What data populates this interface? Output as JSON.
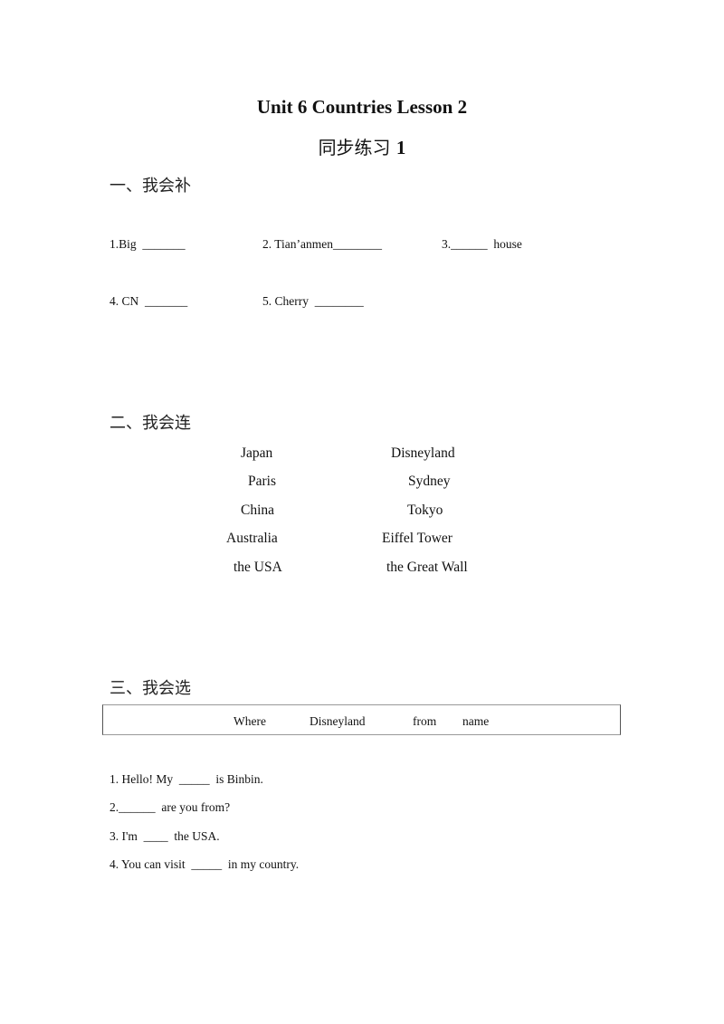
{
  "header": {
    "title": "Unit 6 Countries Lesson 2",
    "subtitle_text": "同步练习 ",
    "subtitle_num": "1"
  },
  "section1": {
    "heading": "一、我会补",
    "items": [
      "1.Big  _______",
      "2. Tian’anmen________",
      "3.______  house",
      "4. CN  _______",
      "5. Cherry  ________"
    ]
  },
  "section2": {
    "heading": "二、我会连",
    "left": [
      "Japan",
      "Paris",
      "China",
      "Australia",
      "the USA"
    ],
    "right": [
      "Disneyland",
      "Sydney",
      "Tokyo",
      "Eiffel Tower",
      "the Great Wall"
    ]
  },
  "section3": {
    "heading": "三、我会选",
    "word_bank": [
      "Where",
      "Disneyland",
      "from",
      "name"
    ],
    "questions": [
      "1. Hello! My  _____  is Binbin.",
      "2.______  are you from?",
      "3. I'm  ____  the USA.",
      "4. You can visit  _____  in my country."
    ]
  }
}
